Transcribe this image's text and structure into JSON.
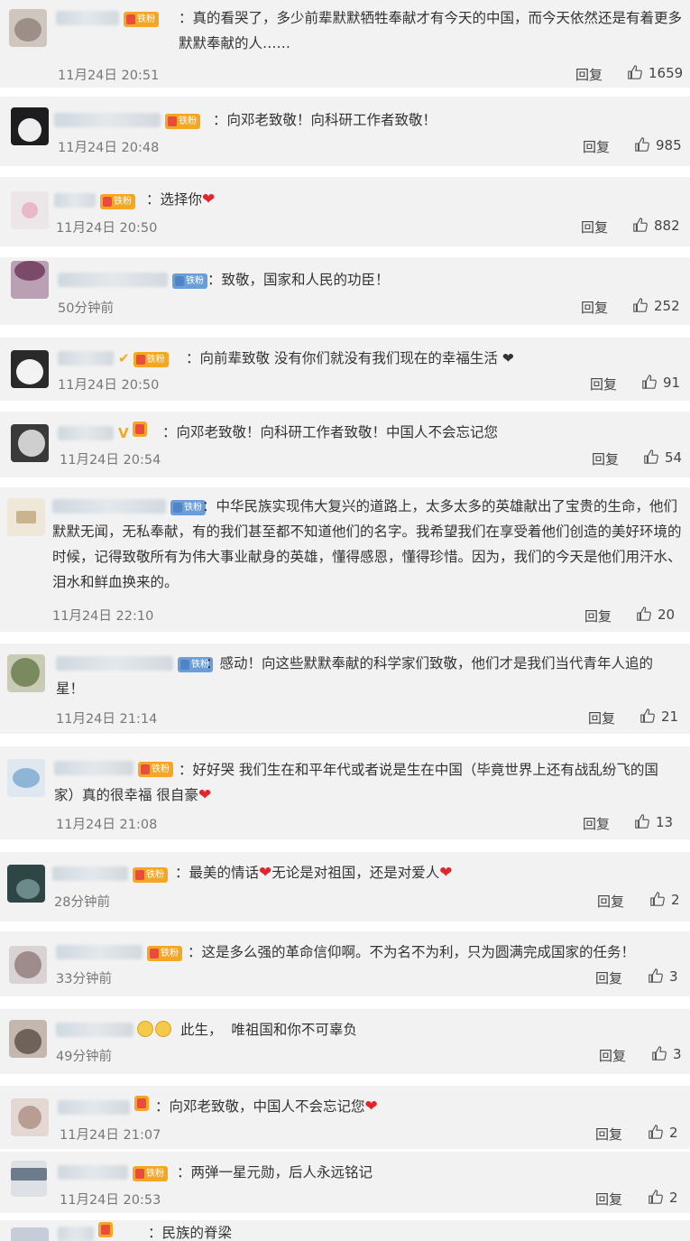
{
  "comments": [
    {
      "text": "：真的看哭了，多少前辈默默牺牲奉献才有今天的中国，而今天依然还是有着更多默默奉献的人……",
      "time": "11月24日 20:51",
      "reply": "回复",
      "likes": "1659"
    },
    {
      "text": "：向邓老致敬！向科研工作者致敬！",
      "time": "11月24日 20:48",
      "reply": "回复",
      "likes": "985"
    },
    {
      "text": "：选择你",
      "time": "11月24日 20:50",
      "reply": "回复",
      "likes": "882"
    },
    {
      "text": "：致敬，国家和人民的功臣！",
      "time": "50分钟前",
      "reply": "回复",
      "likes": "252"
    },
    {
      "text": "：向前辈致敬  没有你们就没有我们现在的幸福生活 ❤",
      "time": "11月24日 20:50",
      "reply": "回复",
      "likes": "91"
    },
    {
      "text": "：向邓老致敬！向科研工作者致敬！中国人不会忘记您",
      "time": "11月24日 20:54",
      "reply": "回复",
      "likes": "54"
    },
    {
      "text": "：中华民族实现伟大复兴的道路上，太多太多的英雄献出了宝贵的生命，他们默默无闻，无私奉献，有的我们甚至都不知道他们的名字。我希望我们在享受着他们创造的美好环境的时候，记得致敬所有为伟大事业献身的英雄，懂得感恩，懂得珍惜。因为，我们的今天是他们用汗水、泪水和鲜血换来的。",
      "time": "11月24日 22:10",
      "reply": "回复",
      "likes": "20"
    },
    {
      "text": "：感动！向这些默默奉献的科学家们致敬，他们才是我们当代青年人追的星！",
      "time": "11月24日 21:14",
      "reply": "回复",
      "likes": "21"
    },
    {
      "text": "：好好哭 我们生在和平年代或者说是生在中国（毕竟世界上还有战乱纷飞的国家）真的很幸福 很自豪",
      "time": "11月24日 21:08",
      "reply": "回复",
      "likes": "13"
    },
    {
      "text": "：最美的情话",
      "text2": "无论是对祖国，还是对爱人",
      "time": "28分钟前",
      "reply": "回复",
      "likes": "2"
    },
    {
      "text": "：这是多么强的革命信仰啊。不为名不为利，只为圆满完成国家的任务！",
      "time": "33分钟前",
      "reply": "回复",
      "likes": "3"
    },
    {
      "text": "此生，  唯祖国和你不可辜负",
      "time": "49分钟前",
      "reply": "回复",
      "likes": "3"
    },
    {
      "text": "：向邓老致敬，中国人不会忘记您",
      "time": "11月24日 21:07",
      "reply": "回复",
      "likes": "2"
    },
    {
      "text": "：两弹一星元勋，后人永远铭记",
      "time": "11月24日 20:53",
      "reply": "回复",
      "likes": "2"
    },
    {
      "text": "：民族的脊梁"
    }
  ],
  "badge_label": "铁粉",
  "colors": {
    "card_bg": "#f2f2f2",
    "badge": "#f5a623",
    "badge_blue": "#6a9ed9",
    "heart": "#e3242b"
  }
}
